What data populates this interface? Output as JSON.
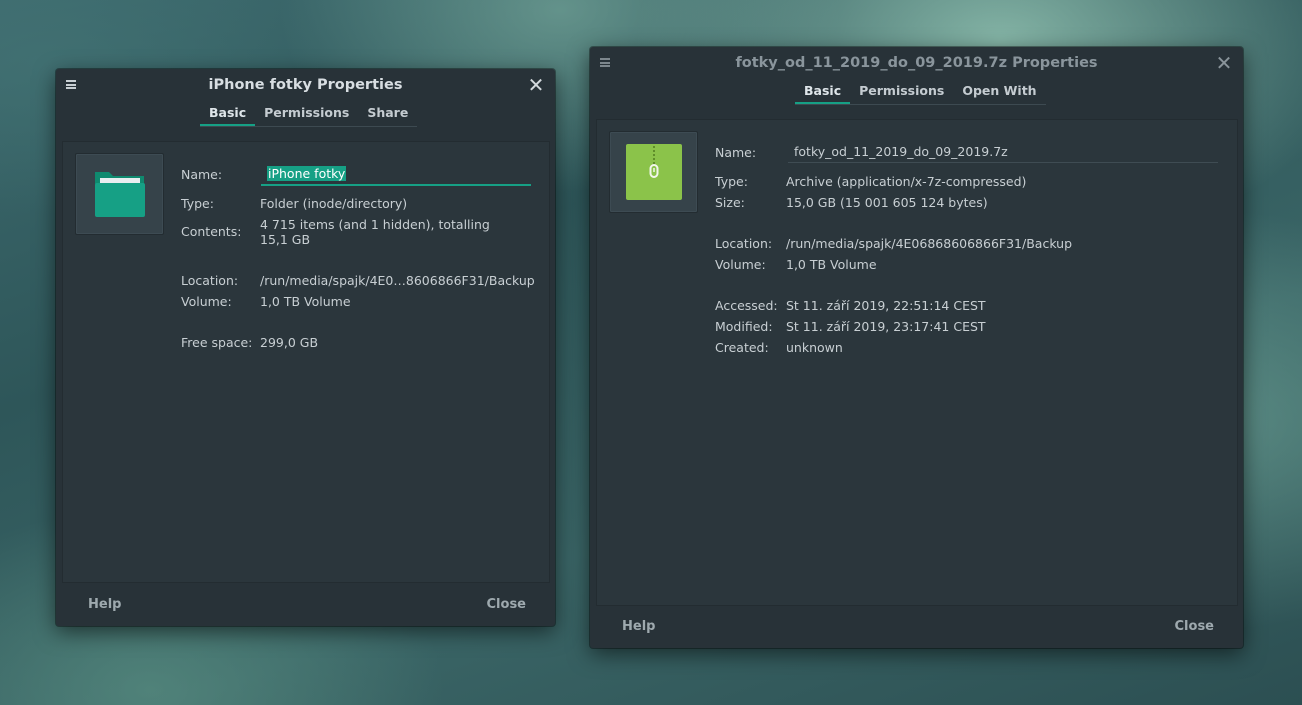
{
  "left_window": {
    "title": "iPhone fotky Properties",
    "tabs": [
      "Basic",
      "Permissions",
      "Share"
    ],
    "name_label": "Name:",
    "name_value": "iPhone fotky",
    "type_label": "Type:",
    "type_value": "Folder (inode/directory)",
    "contents_label": "Contents:",
    "contents_line1": "4 715 items (and 1 hidden), totalling",
    "contents_line2": "15,1  GB",
    "location_label": "Location:",
    "location_value": "/run/media/spajk/4E0…8606866F31/Backup",
    "volume_label": "Volume:",
    "volume_value": "1,0 TB Volume",
    "free_label": "Free space:",
    "free_value": "299,0  GB",
    "help": "Help",
    "close": "Close",
    "icon": "folder-icon",
    "accent": "#16a085"
  },
  "right_window": {
    "title": "fotky_od_11_2019_do_09_2019.7z Properties",
    "tabs": [
      "Basic",
      "Permissions",
      "Open With"
    ],
    "name_label": "Name:",
    "name_value": "fotky_od_11_2019_do_09_2019.7z",
    "type_label": "Type:",
    "type_value": "Archive (application/x-7z-compressed)",
    "size_label": "Size:",
    "size_value": "15,0  GB (15 001 605 124 bytes)",
    "location_label": "Location:",
    "location_value": "/run/media/spajk/4E06868606866F31/Backup",
    "volume_label": "Volume:",
    "volume_value": "1,0 TB Volume",
    "accessed_label": "Accessed:",
    "accessed_value": "St  11.  září  2019,  22:51:14  CEST",
    "modified_label": "Modified:",
    "modified_value": "St  11.  září  2019,  23:17:41  CEST",
    "created_label": "Created:",
    "created_value": "unknown",
    "help": "Help",
    "close": "Close",
    "icon": "archive-icon",
    "icon_color": "#8bc34a"
  }
}
